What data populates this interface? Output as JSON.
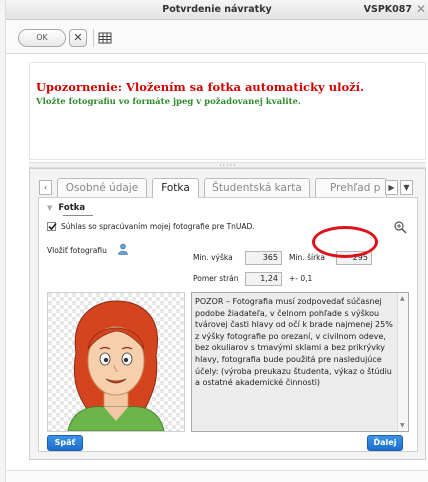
{
  "window": {
    "title": "Potvrdenie návratky",
    "code": "VSPK087"
  },
  "toolbar": {
    "ok_label": "OK",
    "cancel_glyph": "✕"
  },
  "warning": {
    "title": "Upozornenie: Vložením sa fotka automaticky uloží.",
    "subtitle": "Vložte fotografiu vo formáte jpeg v požadovanej kvalite."
  },
  "tabs": [
    {
      "label": "Osobné údaje",
      "active": false
    },
    {
      "label": "Fotka",
      "active": true
    },
    {
      "label": "Študentská karta",
      "active": false
    },
    {
      "label": "Prehľad p",
      "active": false
    }
  ],
  "section": {
    "title": "Fotka"
  },
  "consent": {
    "label": "Súhlas so spracúvaním mojej fotografie pre TnUAD.",
    "checked": true
  },
  "upload": {
    "label": "Vložiť fotografiu"
  },
  "fields": {
    "min_height_label": "Min. výška",
    "min_height_value": "365",
    "min_width_label": "Min. šírka",
    "min_width_value": "295",
    "ratio_label": "Pomer strán",
    "ratio_value": "1,24",
    "ratio_tolerance": "+- 0,1"
  },
  "notice": {
    "text": "POZOR – Fotografia musí zodpovedať súčasnej podobe žiadateľa, v čelnom pohľade s výškou tvárovej časti hlavy od očí k brade najmenej 25%  z výšky fotografie po orezaní, v civilnom odeve, bez okuliarov s tmavými sklami a bez prikrývky hlavy, fotografia bude použitá pre nasledujúce účely: (výroba preukazu študenta, výkaz o štúdiu a ostatné akademické činnosti)"
  },
  "buttons": {
    "back": "Späť",
    "next": "Ďalej"
  },
  "colors": {
    "warning_red": "#d00000",
    "warning_green": "#2e8b2e",
    "button_blue": "#1d6fcd",
    "highlight_ring": "#e0101a"
  }
}
